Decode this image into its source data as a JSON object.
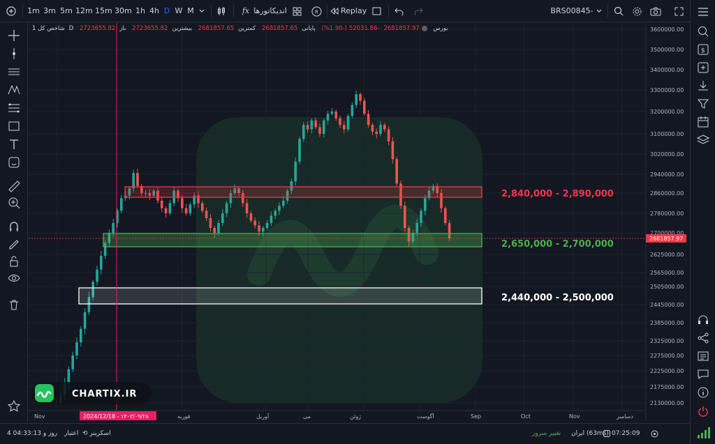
{
  "toolbar": {
    "timeframes": [
      "1m",
      "3m",
      "5m",
      "12m",
      "15m",
      "30m",
      "1h",
      "4h",
      "D",
      "W",
      "M"
    ],
    "active_timeframe": "D",
    "indicators_label": "اندیکاتورها",
    "replay_label": "Replay",
    "symbol_code": "BRS00845-1"
  },
  "legend": {
    "symbol": "شاخص کل",
    "interval": "1D",
    "exchange": "بورس",
    "open_label": "باز",
    "open_value": "2723655.82",
    "high_label": "بیشترین",
    "high_value": "2723655.82",
    "low_label": "کمترین",
    "low_value": "2681857.65",
    "close_label": "پایانی",
    "close_value": "2681857.65",
    "change_value": "-52031.86 (-1.90%)",
    "extra_value": "2681857.97"
  },
  "price_axis": {
    "ticks": [
      "3600000.00",
      "3500000.00",
      "3400000.00",
      "3300000.00",
      "3200000.00",
      "3100000.00",
      "3020000.00",
      "2940000.00",
      "2860000.00",
      "2780000.00",
      "2700000.00",
      "2625000.00",
      "2565000.00",
      "2505000.00",
      "2445000.00",
      "2385000.00",
      "2325000.00",
      "2275000.00",
      "2225000.00",
      "2175000.00",
      "2130000.00"
    ],
    "current_price": "2681857.97"
  },
  "time_axis": {
    "labels": [
      "Nov",
      "فوریه",
      "آوریل",
      "می",
      "ژوئن",
      "آگوست",
      "Sep",
      "Oct",
      "Nov",
      "دسامبر"
    ],
    "crosshair_date": "2024/12/18 - ۱۴۰۳/۰۹/۲۸"
  },
  "zones": [
    {
      "label": "2,840,000 - 2,890,000",
      "color": "#f23645"
    },
    {
      "label": "2,650,000 - 2,700,000",
      "color": "#4caf50"
    },
    {
      "label": "2,440,000 - 2,500,000",
      "color": "#ffffff"
    }
  ],
  "watermark": {
    "brand": "CHARTIX.IR"
  },
  "bottombar": {
    "credit_label": "اعتبار",
    "credit_value": "4 روز و 04:33:13",
    "screener_label": "اسکرینر",
    "change_server_label": "تغییر سرور",
    "server_status": "ایران (63ms)",
    "clock": "07:25:09"
  },
  "colors": {
    "background": "#131722",
    "up": "#26a69a",
    "down": "#ef5350",
    "accent": "#2962ff",
    "crosshair": "#e91e63"
  },
  "chart_data": {
    "type": "candlestick",
    "title": "",
    "y_axis_range": [
      2130000,
      3600000
    ],
    "closes": [
      2130000,
      2152000,
      2185000,
      2230000,
      2275000,
      2320000,
      2365000,
      2420000,
      2470000,
      2525000,
      2575000,
      2620000,
      2665000,
      2700000,
      2740000,
      2790000,
      2840000,
      2850000,
      2880000,
      2945000,
      2890000,
      2860000,
      2860000,
      2850000,
      2870000,
      2830000,
      2800000,
      2780000,
      2820000,
      2870000,
      2840000,
      2800000,
      2780000,
      2815000,
      2850000,
      2820000,
      2790000,
      2760000,
      2720000,
      2700000,
      2740000,
      2780000,
      2820000,
      2860000,
      2880000,
      2860000,
      2820000,
      2780000,
      2750000,
      2730000,
      2705000,
      2720000,
      2740000,
      2770000,
      2790000,
      2810000,
      2830000,
      2870000,
      2910000,
      2990000,
      3080000,
      3140000,
      3120000,
      3160000,
      3130000,
      3100000,
      3160000,
      3190000,
      3200000,
      3170000,
      3140000,
      3120000,
      3180000,
      3230000,
      3280000,
      3250000,
      3190000,
      3140000,
      3110000,
      3100000,
      3140000,
      3120000,
      3070000,
      3000000,
      2900000,
      2810000,
      2720000,
      2670000,
      2700000,
      2740000,
      2790000,
      2840000,
      2870000,
      2890000,
      2860000,
      2800000,
      2740000,
      2682000
    ]
  }
}
